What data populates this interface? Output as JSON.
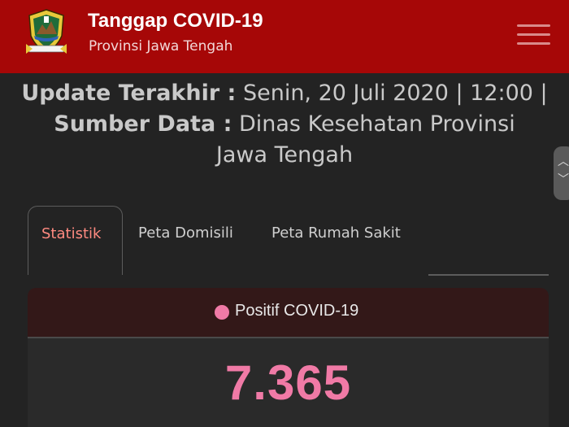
{
  "header": {
    "title": "Tanggap COVID-19",
    "subtitle": "Provinsi Jawa Tengah",
    "logo_icon": "central-java-emblem-icon",
    "menu_icon": "hamburger-menu-icon",
    "background_color": "#a60707"
  },
  "update": {
    "last_update_label": "Update Terakhir :",
    "last_update_value": "Senin, 20 Juli 2020 | 12:00 |",
    "source_label": "Sumber Data :",
    "source_value_line1": "Dinas Kesehatan Provinsi",
    "source_value_line2": "Jawa Tengah"
  },
  "tabs": [
    {
      "label": "Statistik",
      "active": true
    },
    {
      "label": "Peta Domisili",
      "active": false
    },
    {
      "label": "Peta Rumah Sakit",
      "active": false
    }
  ],
  "stat_card": {
    "title": "Positif COVID-19",
    "value": "7.365",
    "accent_color": "#f07aa6"
  }
}
